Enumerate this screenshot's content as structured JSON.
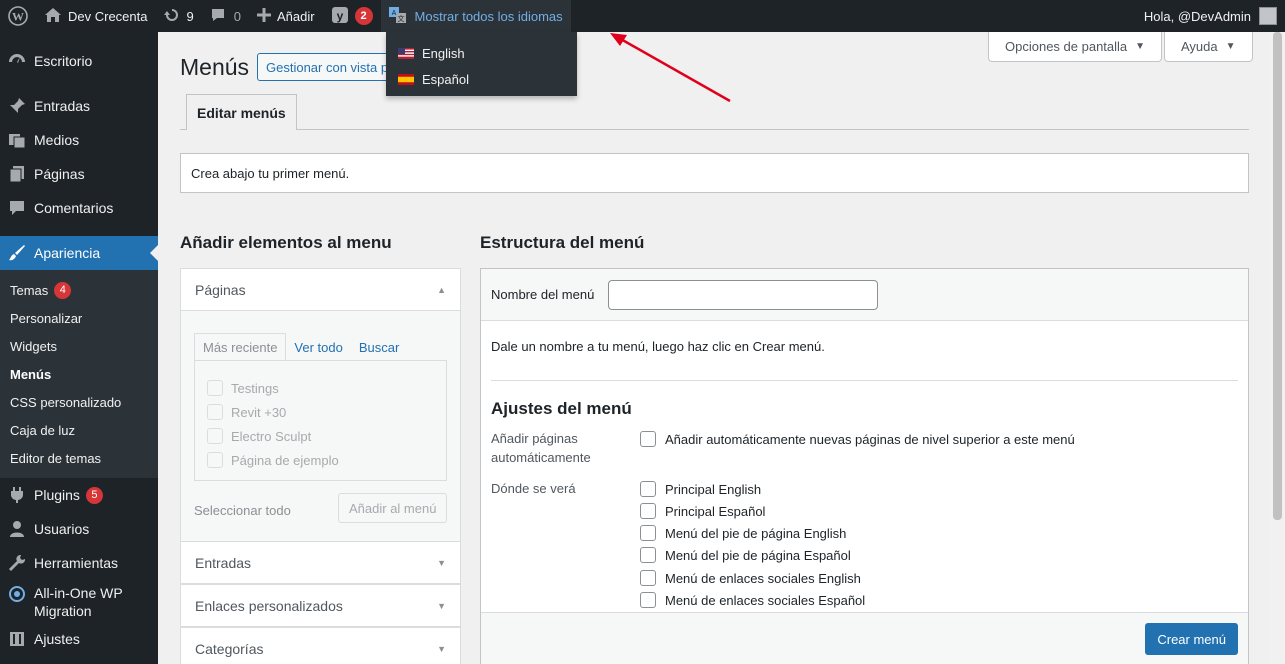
{
  "adminbar": {
    "site_name": "Dev Crecenta",
    "updates_count": "9",
    "comments_count": "0",
    "add_label": "Añadir",
    "yoast_badge": "2",
    "lang_label": "Mostrar todos los idiomas",
    "greeting": "Hola, @DevAdmin"
  },
  "lang_dropdown": {
    "items": [
      {
        "label": "English",
        "flag": "us-flag"
      },
      {
        "label": "Español",
        "flag": "es-flag"
      }
    ]
  },
  "sidebar": {
    "items": {
      "escritorio": "Escritorio",
      "entradas": "Entradas",
      "medios": "Medios",
      "paginas": "Páginas",
      "comentarios": "Comentarios",
      "apariencia": "Apariencia",
      "plugins": "Plugins",
      "plugins_badge": "5",
      "usuarios": "Usuarios",
      "herramientas": "Herramientas",
      "migration": "All-in-One WP Migration",
      "ajustes": "Ajustes"
    },
    "submenu": {
      "temas": "Temas",
      "temas_badge": "4",
      "personalizar": "Personalizar",
      "widgets": "Widgets",
      "menus": "Menús",
      "css": "CSS personalizado",
      "caja_luz": "Caja de luz",
      "editor_temas": "Editor de temas"
    }
  },
  "main": {
    "screen_options": "Opciones de pantalla",
    "help": "Ayuda",
    "title": "Menús",
    "manage_button": "Gestionar con vista previa en vivo",
    "tab": "Editar menús",
    "notice": "Crea abajo tu primer menú.",
    "add_items_title": "Añadir elementos al menu",
    "structure_title": "Estructura del menú"
  },
  "accordion": {
    "paginas": "Páginas",
    "tabs": [
      "Más reciente",
      "Ver todo",
      "Buscar"
    ],
    "pages": [
      "Testings",
      "Revit +30",
      "Electro Sculpt",
      "Página de ejemplo"
    ],
    "select_all": "Seleccionar todo",
    "add_to_menu": "Añadir al menú",
    "entradas": "Entradas",
    "enlaces": "Enlaces personalizados",
    "categorias": "Categorías"
  },
  "structure": {
    "name_label": "Nombre del menú",
    "name_value": "",
    "instruction": "Dale un nombre a tu menú, luego haz clic en Crear menú.",
    "settings_title": "Ajustes del menú",
    "auto_add_label": "Añadir páginas automáticamente",
    "auto_add_option": "Añadir automáticamente nuevas páginas de nivel superior a este menú",
    "location_label": "Dónde se verá",
    "locations": [
      "Principal English",
      "Principal Español",
      "Menú del pie de página English",
      "Menú del pie de página Español",
      "Menú de enlaces sociales English",
      "Menú de enlaces sociales Español"
    ],
    "create_button": "Crear menú"
  },
  "colors": {
    "admin_bar": "#1d2327",
    "accent": "#2271b1",
    "badge": "#d63638",
    "annotation_arrow": "#e0001b"
  }
}
